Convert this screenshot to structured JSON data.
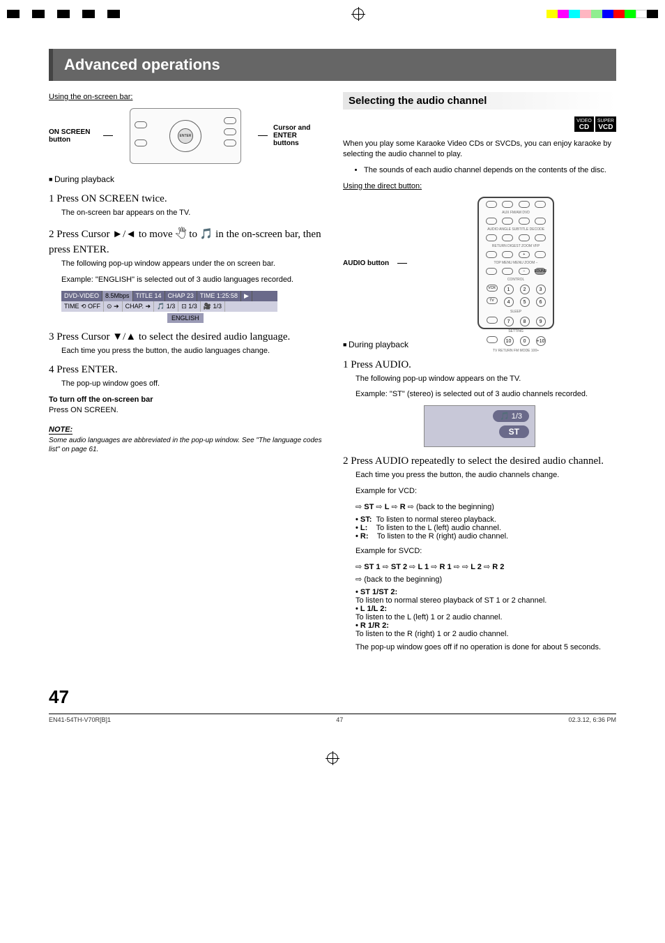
{
  "chapter_title": "Advanced operations",
  "left": {
    "using_bar": "Using the on-screen bar:",
    "callout_onscreen": "ON SCREEN button",
    "callout_cursor": "Cursor and ENTER buttons",
    "during": "During playback",
    "step1_h": "1  Press ON SCREEN twice.",
    "step1_p": "The on-screen bar appears on the TV.",
    "step2_h": "2  Press Cursor ►/◄ to move 🖑 to 🎵      in the on-screen bar, then press ENTER.",
    "step2_p1": "The following pop-up window appears under the on screen bar.",
    "step2_p2": "Example:  \"ENGLISH\" is selected out of 3 audio languages recorded.",
    "osd_top": [
      "DVD-VIDEO",
      "8.5Mbps",
      "TITLE 14",
      "CHAP 23",
      "TIME 1:25:58",
      "▶"
    ],
    "osd_bot": [
      "TIME ⟲ OFF",
      "⊙ ➔",
      "CHAP. ➔",
      "🎵 1/3",
      "⊡ 1/3",
      "🎥 1/3"
    ],
    "lang_tag": "ENGLISH",
    "step3_h": "3  Press Cursor ▼/▲ to select the desired audio language.",
    "step3_p": "Each time you press the button, the audio languages change.",
    "step4_h": "4  Press ENTER.",
    "step4_p": "The pop-up window goes off.",
    "turnoff_h": "To turn off  the on-screen bar",
    "turnoff_p": "Press ON SCREEN.",
    "note_h": "NOTE:",
    "note_p": "Some audio languages are abbreviated in the pop-up window. See \"The language codes list\" on page 61."
  },
  "right": {
    "section_title": "Selecting the audio channel",
    "badges": [
      {
        "top": "VIDEO",
        "bot": "CD"
      },
      {
        "top": "SUPER",
        "bot": "VCD"
      }
    ],
    "intro": "When you play some Karaoke Video CDs or SVCDs, you can enjoy karaoke by selecting the audio channel to play.",
    "intro_bullet": "The sounds of each audio channel depends on the contents of the disc.",
    "using_direct": "Using the direct button:",
    "audio_btn_label": "AUDIO button",
    "during": "During playback",
    "step1_h": "1  Press AUDIO.",
    "step1_p1": "The following pop-up window appears on the TV.",
    "step1_p2": "Example:  \"ST\" (stereo) is selected out of 3 audio channels recorded.",
    "popup_top": "🎵 1/3",
    "popup_bot": "ST",
    "step2_h": "2  Press AUDIO repeatedly to select the desired audio channel.",
    "step2_p": "Each time you press the button, the audio channels change.",
    "ex_vcd_h": "Example for VCD:",
    "seq_vcd": "⇨ ST ⇨ L ⇨ R ⇨ (back to the beginning)",
    "vcd_items": [
      {
        "k": "ST:",
        "v": "To listen to normal stereo playback."
      },
      {
        "k": "L:",
        "v": "To listen to the L (left) audio channel."
      },
      {
        "k": "R:",
        "v": "To listen to the R (right) audio channel."
      }
    ],
    "ex_svcd_h": "Example for SVCD:",
    "seq_svcd1": "⇨ ST 1 ⇨ ST 2 ⇨ L 1 ⇨ R 1 ⇨ ⇨ L 2 ⇨ R 2",
    "seq_svcd2": "⇨ (back to the beginning)",
    "svcd_items": [
      {
        "k": "ST 1/ST 2:",
        "v": "To listen to normal stereo playback of ST 1 or 2 channel."
      },
      {
        "k": "L 1/L 2:",
        "v": "To listen to the L (left) 1 or 2 audio channel."
      },
      {
        "k": "R 1/R 2:",
        "v": "To listen to the R (right) 1 or 2 audio channel."
      }
    ],
    "closing": "The pop-up window goes off if no operation is done for about 5 seconds."
  },
  "page_number": "47",
  "footer": {
    "left": "EN41-54TH-V70R[B]1",
    "mid": "47",
    "right": "02.3.12, 6:36 PM"
  }
}
